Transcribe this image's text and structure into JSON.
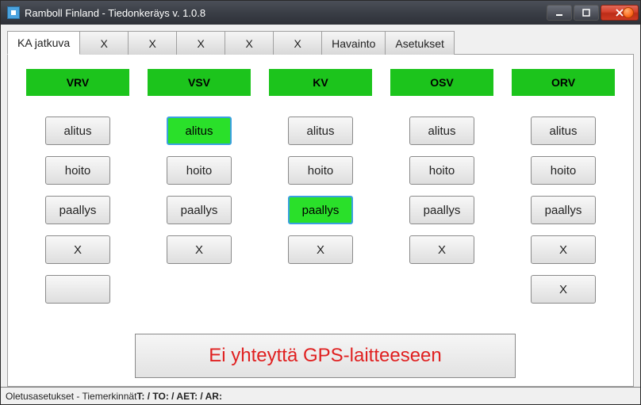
{
  "window": {
    "title": "Ramboll Finland - Tiedonkeräys v. 1.0.8"
  },
  "tabs": [
    {
      "label": "KA jatkuva",
      "active": true
    },
    {
      "label": "X"
    },
    {
      "label": "X"
    },
    {
      "label": "X"
    },
    {
      "label": "X"
    },
    {
      "label": "X"
    },
    {
      "label": "Havainto"
    },
    {
      "label": "Asetukset"
    }
  ],
  "columns": [
    {
      "header": "VRV",
      "cells": [
        {
          "label": "alitus"
        },
        {
          "label": "hoito"
        },
        {
          "label": "paallys"
        },
        {
          "label": "X"
        },
        {
          "label": "",
          "empty": true
        }
      ]
    },
    {
      "header": "VSV",
      "cells": [
        {
          "label": "alitus",
          "active": true
        },
        {
          "label": "hoito"
        },
        {
          "label": "paallys"
        },
        {
          "label": "X"
        },
        {
          "label": "",
          "blank": true
        }
      ]
    },
    {
      "header": "KV",
      "cells": [
        {
          "label": "alitus"
        },
        {
          "label": "hoito"
        },
        {
          "label": "paallys",
          "active": true
        },
        {
          "label": "X"
        },
        {
          "label": "",
          "blank": true
        }
      ]
    },
    {
      "header": "OSV",
      "cells": [
        {
          "label": "alitus"
        },
        {
          "label": "hoito"
        },
        {
          "label": "paallys"
        },
        {
          "label": "X"
        },
        {
          "label": "",
          "blank": true
        }
      ]
    },
    {
      "header": "ORV",
      "cells": [
        {
          "label": "alitus"
        },
        {
          "label": "hoito"
        },
        {
          "label": "paallys"
        },
        {
          "label": "X"
        },
        {
          "label": "X"
        }
      ]
    }
  ],
  "gps_message": "Ei yhteyttä GPS-laitteeseen",
  "status": {
    "prefix": "Oletusasetukset - Tiemerkinnät ",
    "bold": "T: / TO: / AET: / AR:"
  }
}
